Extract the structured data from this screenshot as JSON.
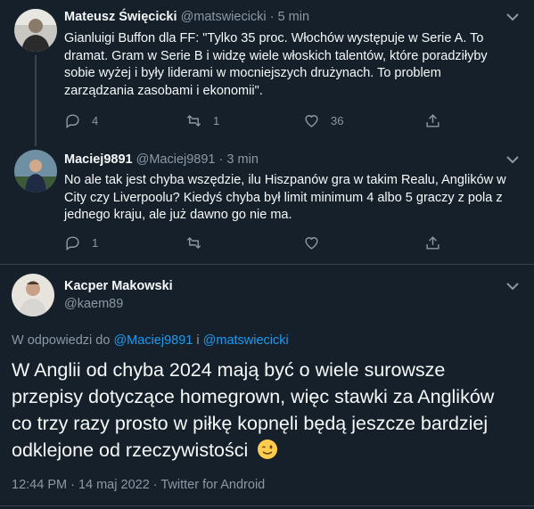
{
  "tweets": [
    {
      "name": "Mateusz Święcicki",
      "handle": "@matswiecicki",
      "separator": "·",
      "time": "5 min",
      "text": "Gianluigi Buffon dla FF: \"Tylko 35 proc. Włochów występuje w Serie A. To dramat. Gram w Serie B i widzę wiele włoskich talentów, które poradziłyby sobie wyżej i były liderami w mocniejszych drużynach. To problem zarządzania zasobami i ekonomii\".",
      "replies": "4",
      "retweets": "1",
      "likes": "36"
    },
    {
      "name": "Maciej9891",
      "handle": "@Maciej9891",
      "separator": "·",
      "time": "3 min",
      "text": "No ale tak jest chyba wszędzie, ilu Hiszpanów gra w takim Realu, Anglików w City czy Liverpoolu? Kiedyś chyba był limit minimum 4 albo 5 graczy z pola z jednego kraju, ale już dawno go nie ma.",
      "replies": "1",
      "retweets": "",
      "likes": ""
    }
  ],
  "main_tweet": {
    "name": "Kacper Makowski",
    "handle": "@kaem89",
    "reply_prefix": "W odpowiedzi do",
    "mention_1": "@Maciej9891",
    "reply_joiner": "i",
    "mention_2": "@matswiecicki",
    "text": "W Anglii od chyba 2024 mają być o wiele surowsze przepisy dotyczące homegrown, więc stawki za Anglików co trzy razy prosto w piłkę kopnęli będą jeszcze bardziej odklejone od rzeczywistości",
    "emoji": "winking-face",
    "meta": "12:44 PM · 14 maj 2022 · Twitter for Android"
  },
  "colors": {
    "background": "#15202b",
    "text": "#f7f9f9",
    "secondary": "#8b98a5",
    "accent": "#1d9bf0",
    "divider": "#38444d"
  }
}
